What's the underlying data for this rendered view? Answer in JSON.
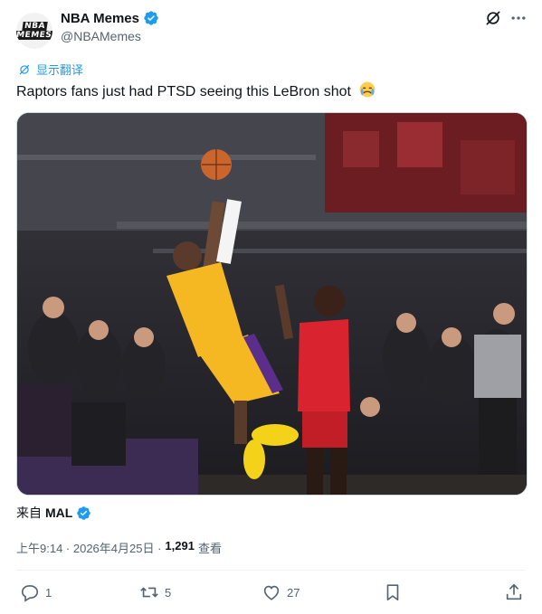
{
  "header": {
    "display_name": "NBA Memes",
    "handle": "@NBAMemes",
    "avatar_text_top": "NBA",
    "avatar_text_bottom": "MEMES"
  },
  "translate_label": "显示翻译",
  "tweet": {
    "text": "Raptors fans just had PTSD seeing this LeBron shot",
    "emoji": "crying-face-emoji"
  },
  "source": {
    "label": "来自",
    "name": "MAL"
  },
  "meta": {
    "time": "上午9:14 · 2026年4月25日 ·",
    "views": "1,291",
    "views_label": "查看"
  },
  "actions": {
    "reply_count": "1",
    "retweet_count": "5",
    "like_count": "27"
  },
  "colors": {
    "accent": "#1d9bf0",
    "text": "#0f1419",
    "muted": "#536471"
  }
}
